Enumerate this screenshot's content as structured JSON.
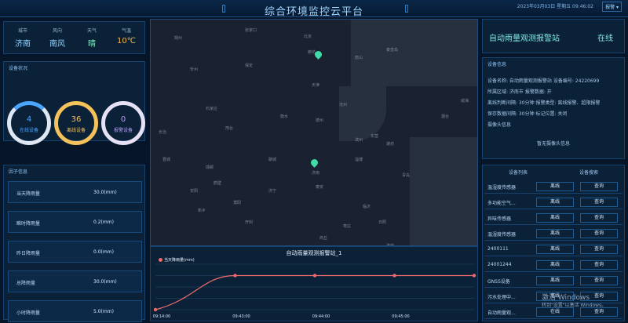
{
  "app": {
    "title": "综合环境监控云平台",
    "datetime": "2023年03月03日 星期五 09:46:02",
    "alarm_label": "报警"
  },
  "weather": [
    {
      "key": "城市",
      "value": "济南",
      "color": "#8fd3ff"
    },
    {
      "key": "风向",
      "value": "南风",
      "color": "#8fd3ff"
    },
    {
      "key": "天气",
      "value": "晴",
      "color": "#7ff0c6"
    },
    {
      "key": "气温",
      "value": "10℃",
      "color": "#f5b64a"
    }
  ],
  "device_status": {
    "title": "设备状况",
    "online": {
      "count": "4",
      "label": "在线设备",
      "fraction": 0.1
    },
    "offline": {
      "count": "36",
      "label": "离线设备",
      "fraction": 0.9
    },
    "alarm": {
      "count": "0",
      "label": "报警设备",
      "fraction": 0
    }
  },
  "factors": {
    "title": "因子信息",
    "rows": [
      {
        "label": "当天降雨量",
        "value": "30.0(mm)"
      },
      {
        "label": "瞬时降雨量",
        "value": "0.2(mm)"
      },
      {
        "label": "昨日降雨量",
        "value": "0.0(mm)"
      },
      {
        "label": "总降雨量",
        "value": "30.0(mm)"
      },
      {
        "label": "小时降雨量",
        "value": "5.0(mm)"
      }
    ]
  },
  "map": {
    "cities": [
      {
        "name": "北京"
      },
      {
        "name": "廊坊"
      },
      {
        "name": "天津"
      },
      {
        "name": "保定"
      },
      {
        "name": "沧州"
      },
      {
        "name": "石家庄"
      },
      {
        "name": "衡水"
      },
      {
        "name": "德州"
      },
      {
        "name": "邢台"
      },
      {
        "name": "东营"
      },
      {
        "name": "滨州"
      },
      {
        "name": "淄博"
      },
      {
        "name": "潍坊"
      },
      {
        "name": "济南"
      },
      {
        "name": "泰安"
      },
      {
        "name": "聊城"
      },
      {
        "name": "邯郸"
      },
      {
        "name": "安阳"
      },
      {
        "name": "鹤壁"
      },
      {
        "name": "濮阳"
      },
      {
        "name": "临沂"
      },
      {
        "name": "枣庄"
      },
      {
        "name": "商丘"
      },
      {
        "name": "日照"
      },
      {
        "name": "青岛"
      },
      {
        "name": "烟台"
      },
      {
        "name": "威海"
      },
      {
        "name": "朔州"
      },
      {
        "name": "忻州"
      },
      {
        "name": "长治"
      },
      {
        "name": "晋城"
      },
      {
        "name": "新乡"
      },
      {
        "name": "开封"
      },
      {
        "name": "济宁"
      },
      {
        "name": "徐州"
      },
      {
        "name": "宿迁"
      },
      {
        "name": "淮安"
      },
      {
        "name": "唐山"
      },
      {
        "name": "秦皇岛"
      },
      {
        "name": "张家口"
      }
    ]
  },
  "chart_data": {
    "type": "line",
    "title": "自动雨量观测报警站_1",
    "series": [
      {
        "name": "当天降雨量(mm)",
        "values": [
          0,
          30,
          30,
          30,
          30
        ]
      }
    ],
    "x": [
      "09:14:00",
      "09:43:00",
      "09:44:00",
      "09:45:00",
      ""
    ],
    "ylim": [
      0,
      40
    ],
    "color": "#f06c6c"
  },
  "station": {
    "name": "自动雨量观测报警站",
    "status": "在线"
  },
  "device_info": {
    "title": "设备信息",
    "lines": [
      "设备名称: 自动雨量观测报警站   设备编号: 24220699",
      "所属区域: 济南市   报警数据: 开",
      "离线判断间隔: 30分钟   报警类型: 离线报警、超限报警",
      "保存数据间隔: 30分钟   标记位置: 关闭",
      "摄像头信息"
    ],
    "no_camera": "暂无摄像头信息"
  },
  "device_list": {
    "tabs": [
      "设备列表",
      "设备搜索"
    ],
    "rows": [
      {
        "name": "温湿度传感器",
        "status": "离线",
        "action": "查询"
      },
      {
        "name": "多功能空气...",
        "status": "离线",
        "action": "查询"
      },
      {
        "name": "异味传感器",
        "status": "离线",
        "action": "查询"
      },
      {
        "name": "温湿度传感器",
        "status": "离线",
        "action": "查询"
      },
      {
        "name": "2400111",
        "status": "离线",
        "action": "查询"
      },
      {
        "name": "24001244",
        "status": "离线",
        "action": "查询"
      },
      {
        "name": "GNSS设备",
        "status": "离线",
        "action": "查询"
      },
      {
        "name": "污水处理中...",
        "status": "离线",
        "action": "查询"
      },
      {
        "name": "自动雨量观...",
        "status": "在线",
        "action": "查询"
      }
    ]
  },
  "watermark": {
    "line1": "激活 Windows",
    "line2": "转到\"设置\"以激活 Windows。"
  }
}
